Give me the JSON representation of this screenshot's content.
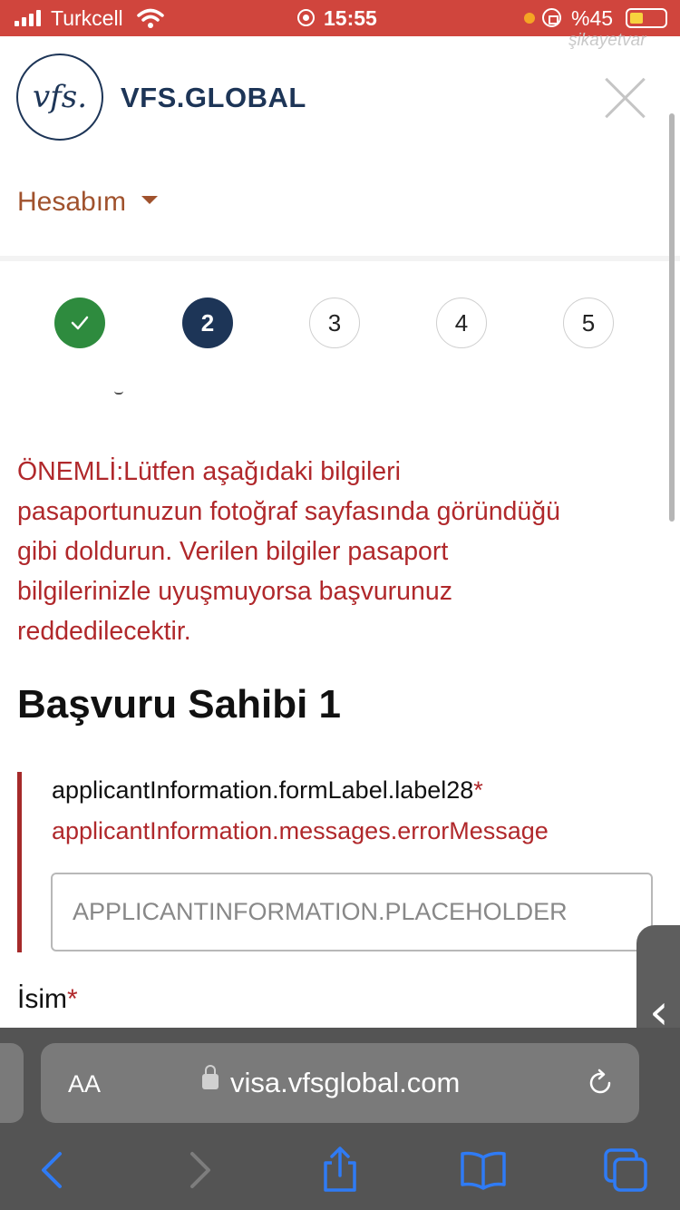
{
  "status_bar": {
    "carrier": "Turkcell",
    "time": "15:55",
    "battery_percent": "%45"
  },
  "watermark": "şikayetvar",
  "header": {
    "logo_mark": "vfs.",
    "brand": "VFS.GLOBAL",
    "account_label": "Hesabım",
    "icons": [
      "close-icon",
      "caret-down-icon"
    ]
  },
  "stepper": {
    "steps": [
      {
        "label": "",
        "state": "completed",
        "icon": "check-icon"
      },
      {
        "label": "2",
        "state": "active"
      },
      {
        "label": "3",
        "state": "pending"
      },
      {
        "label": "4",
        "state": "pending"
      },
      {
        "label": "5",
        "state": "pending"
      }
    ]
  },
  "form": {
    "notice": "ÖNEMLİ:Lütfen aşağıdaki bilgileri pasaportunuzun fotoğraf sayfasında göründüğü gibi doldurun. Verilen bilgiler pasaport bilgilerinizle uyuşmuyorsa başvurunuz reddedilecektir.",
    "section_title": "Başvuru Sahibi 1",
    "field1_label": "applicantInformation.formLabel.label28",
    "field1_required": "*",
    "field1_error": "applicantInformation.messages.errorMessage",
    "field1_placeholder": "APPLICANTINFORMATION.PLACEHOLDER",
    "field2_label": "İsim",
    "field2_required": "*"
  },
  "browser": {
    "text_size_label": "AA",
    "url": "visa.vfsglobal.com",
    "colors": {
      "status_bar": "#d0453d",
      "brand": "#1d3557",
      "error": "#b0282b",
      "toolbar_icon": "#2f7bf5"
    }
  }
}
